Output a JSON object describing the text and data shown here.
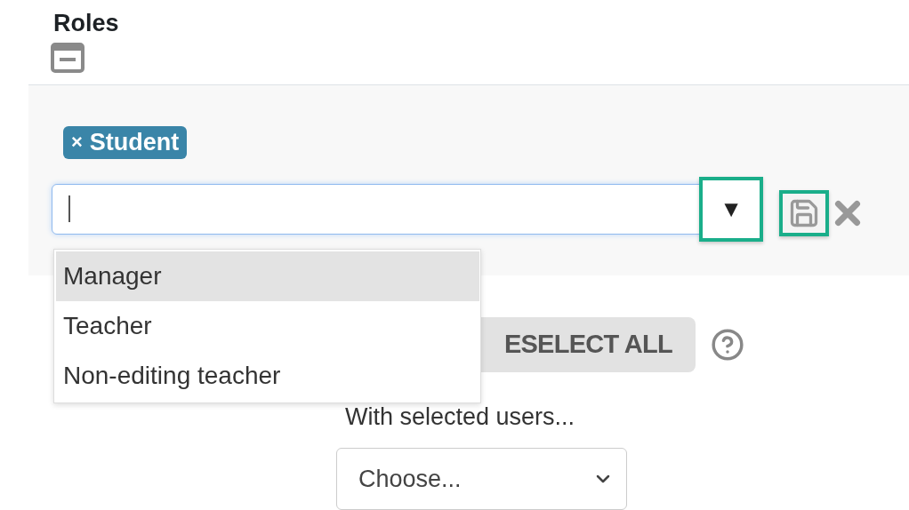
{
  "heading": "Roles",
  "selected_roles": [
    {
      "label": "Student",
      "remove": "×"
    }
  ],
  "combo": {
    "toggle": "▼",
    "toggle_highlighted": true,
    "save_highlighted": true
  },
  "options": [
    {
      "label": "Manager",
      "selected": true
    },
    {
      "label": "Teacher",
      "selected": false
    },
    {
      "label": "Non-editing teacher",
      "selected": false
    }
  ],
  "deselect_button": "ESELECT ALL",
  "bulk_label": "With selected users...",
  "bulk_select": {
    "value": "Choose..."
  }
}
